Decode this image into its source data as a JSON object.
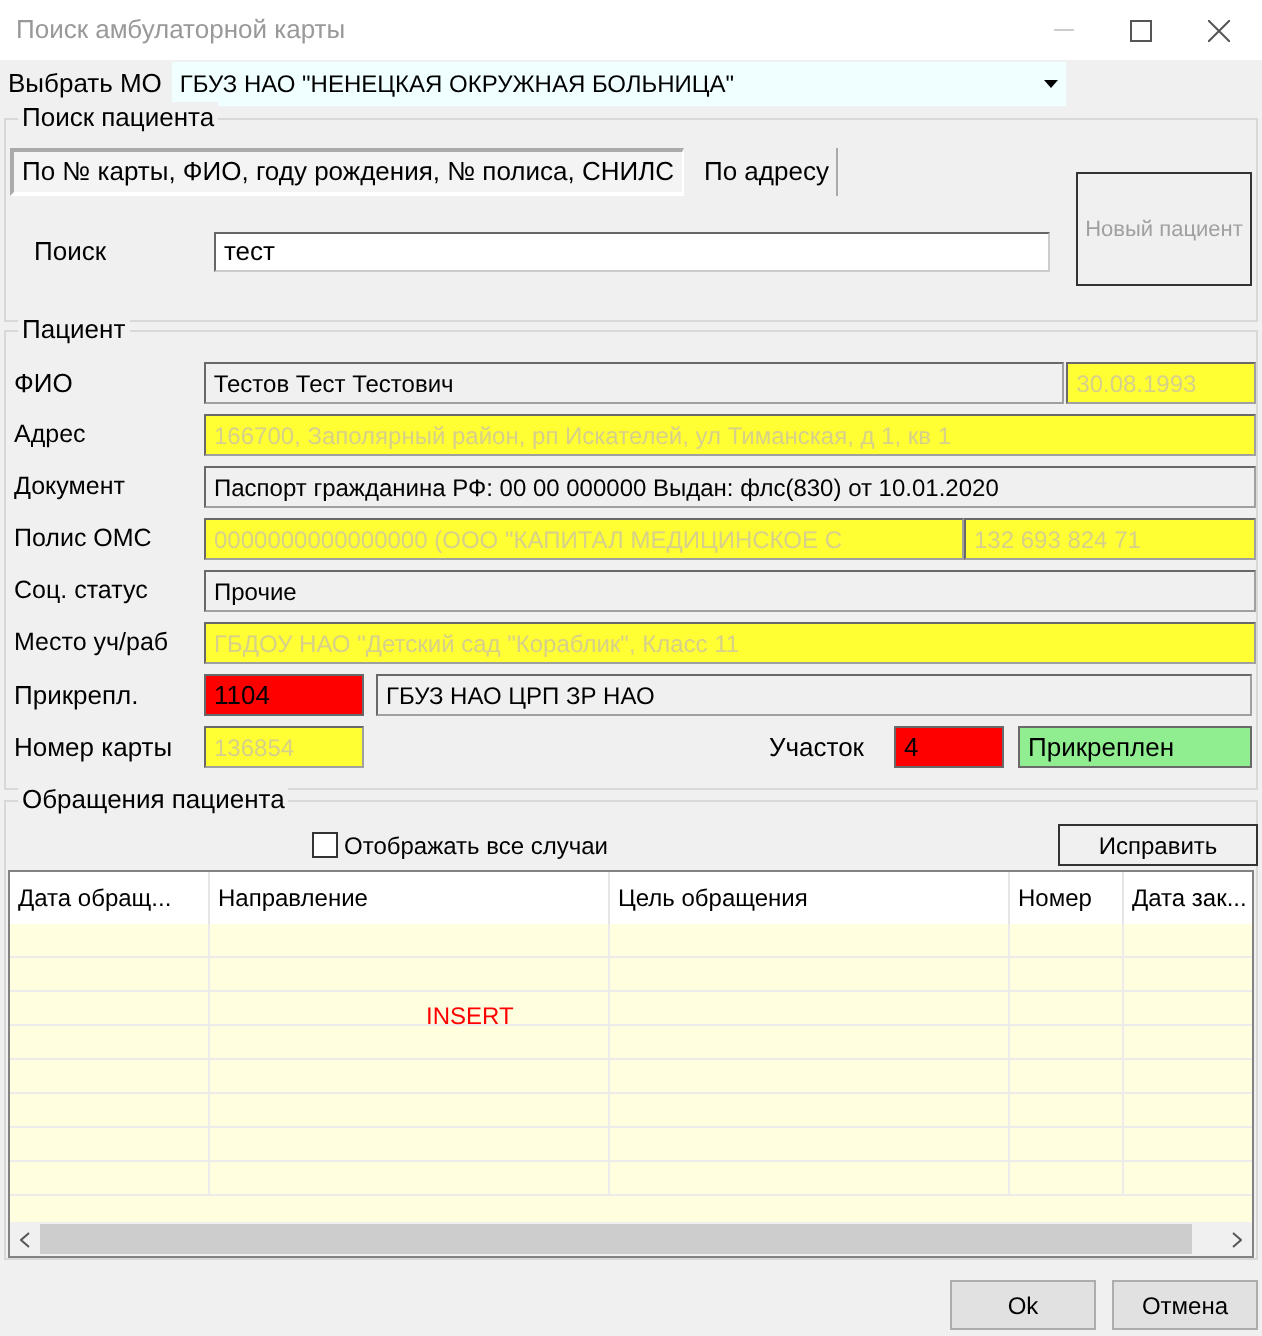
{
  "window": {
    "title": "Поиск амбулаторной карты"
  },
  "mo": {
    "label": "Выбрать МО",
    "value": "ГБУЗ НАО \"НЕНЕЦКАЯ ОКРУЖНАЯ БОЛЬНИЦА\""
  },
  "search_group": {
    "title": "Поиск пациента",
    "tabs": [
      {
        "label": "По № карты, ФИО, году рождения, № полиса, СНИЛС",
        "selected": true
      },
      {
        "label": "По адресу",
        "selected": false
      }
    ],
    "search_label": "Поиск",
    "search_value": "тест",
    "new_patient_button": {
      "label": "Новый пациент",
      "disabled": true
    }
  },
  "patient_group": {
    "title": "Пациент",
    "fio": {
      "label": "ФИО",
      "value": "Тестов Тест Тестович",
      "birth_date": "30.08.1993",
      "birth_date_highlighted": true
    },
    "rows": [
      {
        "label": "Адрес",
        "value": "166700, Заполярный район, рп Искателей, ул Тиманская, д 1, кв 1",
        "highlighted": true
      },
      {
        "label": "Документ",
        "value": "Паспорт гражданина РФ: 00 00 000000 Выдан: флс(830) от 10.01.2020",
        "highlighted": false
      },
      {
        "label": "Полис ОМС",
        "value": "0000000000000000 (ООО \"КАПИТАЛ МЕДИЦИНСКОЕ С",
        "extra": "132 693 824 71",
        "highlighted": true
      },
      {
        "label": "Соц. статус",
        "value": "Прочие",
        "highlighted": false
      },
      {
        "label": "Место уч/раб",
        "value": "ГБДОУ НАО \"Детский сад \"Кораблик\", Класс 11",
        "highlighted": true
      }
    ],
    "attach": {
      "label": "Прикрепл.",
      "code": {
        "value": "1104",
        "color": "#ff0000"
      },
      "name": "ГБУЗ НАО ЦРП ЗР НАО"
    },
    "card": {
      "label": "Номер карты",
      "value": "136854",
      "highlighted": true
    },
    "district": {
      "label": "Участок",
      "value": "4",
      "color": "#ff0000",
      "status": {
        "value": "Прикреплен",
        "color": "#90ee90"
      }
    }
  },
  "appeals_group": {
    "title": "Обращения пациента",
    "show_all": {
      "label": "Отображать все случаи",
      "checked": false
    },
    "fix_button": "Исправить",
    "table": {
      "columns": [
        "Дата обращ...",
        "Направление",
        "Цель обращения",
        "Номер",
        "Дата зак..."
      ],
      "empty_text": "INSERT"
    }
  },
  "buttons": [
    "Ok",
    "Отмена"
  ]
}
